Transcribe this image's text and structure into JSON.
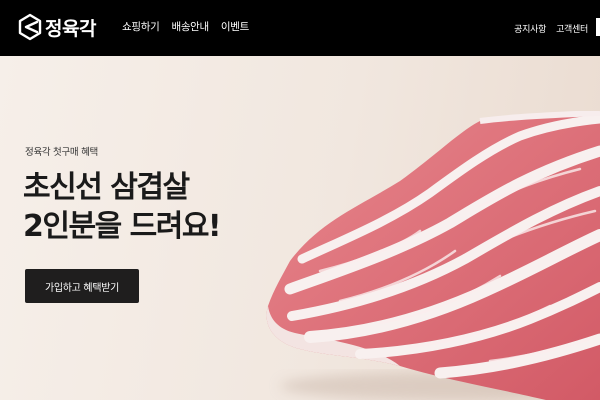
{
  "header": {
    "logo_text": "정육각",
    "nav": [
      "쇼핑하기",
      "배송안내",
      "이벤트"
    ],
    "util": [
      "공지사항",
      "고객센터"
    ]
  },
  "hero": {
    "eyebrow": "정육각 첫구매 혜택",
    "headline_line1": "초신선 삼겹살",
    "headline_line2": "2인분을 드려요!",
    "cta_label": "가입하고 혜택받기"
  },
  "colors": {
    "header_bg": "#000000",
    "hero_bg": "#f4ece6",
    "cta_bg": "#1f1e1e",
    "meat_red": "#d9606a",
    "fat_white": "#f7eeee"
  },
  "icons": [
    "logo-icon",
    "pork-belly-image"
  ]
}
